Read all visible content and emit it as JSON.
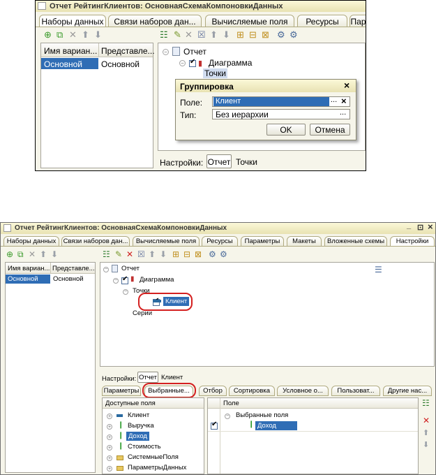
{
  "top": {
    "title": "Отчет РейтингКлиентов: ОсновнаяСхемаКомпоновкиДанных",
    "tabs": [
      "Наборы данных",
      "Связи наборов дан...",
      "Вычисляемые поля",
      "Ресурсы",
      "Парам"
    ],
    "variants": {
      "columns": [
        "Имя вариан...",
        "Представле..."
      ],
      "rows": [
        {
          "name": "Основной",
          "presentation": "Основной"
        }
      ]
    },
    "tree": {
      "report": "Отчет",
      "chart": "Диаграмма",
      "points": "Точки"
    },
    "dialog": {
      "title": "Группировка",
      "field_label": "Поле:",
      "field_value": "Клиент",
      "type_label": "Тип:",
      "type_value": "Без иерархии",
      "ok": "OK",
      "cancel": "Отмена",
      "ellipsis": "...",
      "clear": "×",
      "close": "×"
    },
    "settings_label": "Настройки:",
    "settings_items": [
      "Отчет",
      "Точки"
    ]
  },
  "bottom": {
    "title": "Отчет РейтингКлиентов: ОсновнаяСхемаКомпоновкиДанных",
    "window_controls": [
      "_",
      "⊡",
      "×"
    ],
    "tabs": [
      "Наборы данных",
      "Связи наборов дан...",
      "Вычисляемые поля",
      "Ресурсы",
      "Параметры",
      "Макеты",
      "Вложенные схемы",
      "Настройки"
    ],
    "variants": {
      "columns": [
        "Имя вариан...",
        "Представле..."
      ],
      "rows": [
        {
          "name": "Основной",
          "presentation": "Основной"
        }
      ]
    },
    "tree": {
      "report": "Отчет",
      "chart": "Диаграмма",
      "points": "Точки",
      "client": "Клиент",
      "series": "Серии"
    },
    "settings_label": "Настройки:",
    "settings_items": [
      "Отчет",
      "Клиент"
    ],
    "subtabs": [
      "Параметры",
      "Выбранные...",
      "Отбор",
      "Сортировка",
      "Условное о...",
      "Пользоват...",
      "Другие нас..."
    ],
    "available_fields": {
      "header": "Доступные поля",
      "items": [
        "Клиент",
        "Выручка",
        "Доход",
        "Стоимость",
        "СистемныеПоля",
        "ПараметрыДанных"
      ]
    },
    "selected_fields": {
      "header": "Поле",
      "group": "Выбранные поля",
      "items": [
        "Доход"
      ]
    }
  },
  "colors": {
    "selection": "#2f6db5",
    "window_bg": "#f6f5ea",
    "highlight": "#d42020"
  }
}
